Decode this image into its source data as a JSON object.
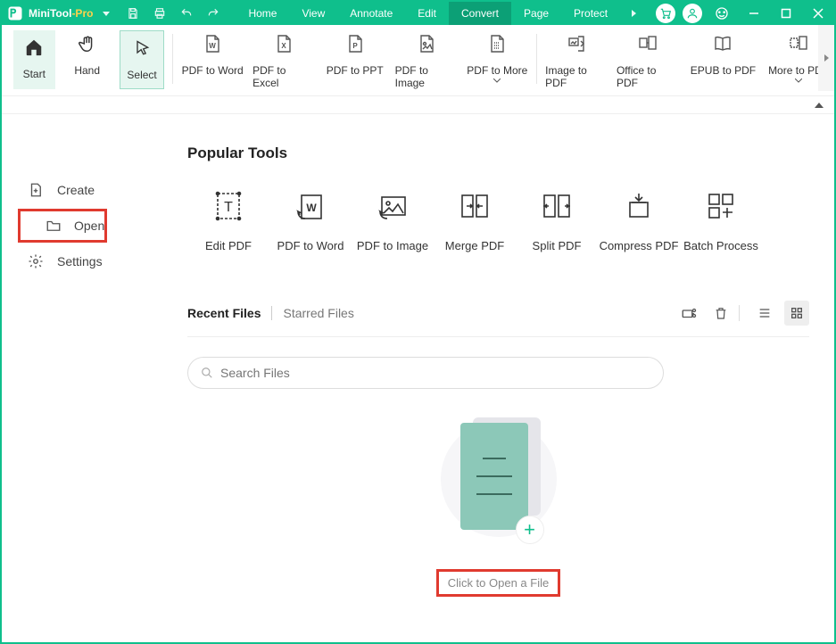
{
  "brand": {
    "name": "MiniTool",
    "suffix": "-Pro"
  },
  "menubar": {
    "items": [
      "Home",
      "View",
      "Annotate",
      "Edit",
      "Convert",
      "Page",
      "Protect"
    ],
    "active_index": 4
  },
  "ribbon": {
    "tools": [
      {
        "label": "Start",
        "icon": "home"
      },
      {
        "label": "Hand",
        "icon": "hand"
      },
      {
        "label": "Select",
        "icon": "cursor"
      }
    ],
    "convert_tools": [
      {
        "label": "PDF to Word",
        "icon": "w"
      },
      {
        "label": "PDF to Excel",
        "icon": "x"
      },
      {
        "label": "PDF to PPT",
        "icon": "p"
      },
      {
        "label": "PDF to Image",
        "icon": "img"
      },
      {
        "label": "PDF to More",
        "icon": "more",
        "dropdown": true
      },
      {
        "label": "Image to PDF",
        "icon": "img2pdf"
      },
      {
        "label": "Office to PDF",
        "icon": "office2pdf"
      },
      {
        "label": "EPUB to PDF",
        "icon": "epub2pdf"
      },
      {
        "label": "More to PDF",
        "icon": "more2pdf",
        "dropdown": true
      }
    ]
  },
  "sidebar": {
    "items": [
      {
        "label": "Create",
        "icon": "create"
      },
      {
        "label": "Open",
        "icon": "folder",
        "highlight": true
      },
      {
        "label": "Settings",
        "icon": "gear"
      }
    ]
  },
  "content": {
    "popular_title": "Popular Tools",
    "popular": [
      {
        "label": "Edit PDF"
      },
      {
        "label": "PDF to Word"
      },
      {
        "label": "PDF to Image"
      },
      {
        "label": "Merge PDF"
      },
      {
        "label": "Split PDF"
      },
      {
        "label": "Compress PDF"
      },
      {
        "label": "Batch Process"
      }
    ],
    "tabs": {
      "recent": "Recent Files",
      "starred": "Starred Files"
    },
    "search_placeholder": "Search Files",
    "open_file_label": "Click to Open a File"
  }
}
